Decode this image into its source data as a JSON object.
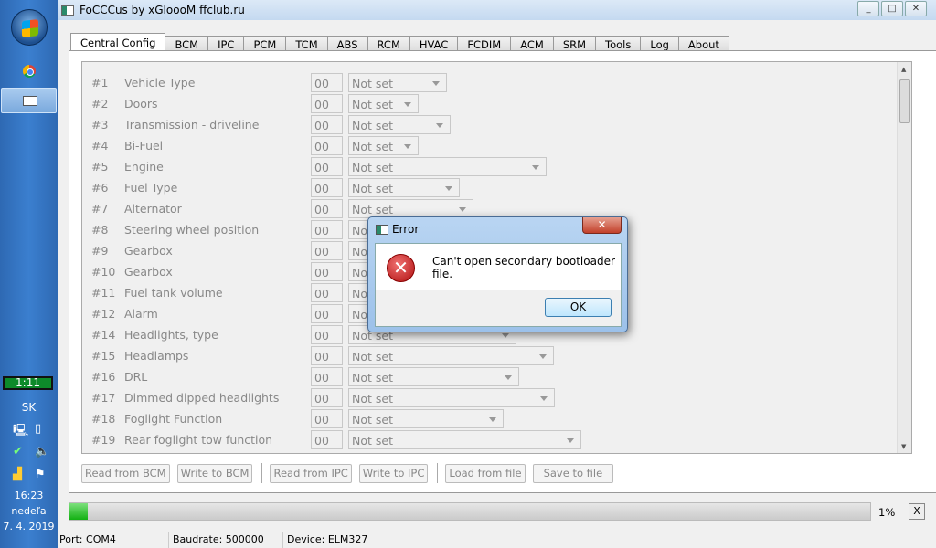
{
  "taskbar": {
    "battery": "1:11",
    "lang": "SK",
    "time": "16:23",
    "day": "nedeľa",
    "date": "7. 4. 2019"
  },
  "window": {
    "title": "FoCCCus by xGloooM ffclub.ru",
    "controls": [
      "_",
      "□",
      "✕"
    ]
  },
  "tabs": [
    "Central Config",
    "BCM",
    "IPC",
    "PCM",
    "TCM",
    "ABS",
    "RCM",
    "HVAC",
    "FCDIM",
    "ACM",
    "SRM",
    "Tools",
    "Log",
    "About"
  ],
  "active_tab": "Central Config",
  "rows": [
    {
      "num": "#1",
      "label": "Vehicle Type",
      "value": "00",
      "select": "Not set"
    },
    {
      "num": "#2",
      "label": "Doors",
      "value": "00",
      "select": "Not set"
    },
    {
      "num": "#3",
      "label": "Transmission - driveline",
      "value": "00",
      "select": "Not set"
    },
    {
      "num": "#4",
      "label": "Bi-Fuel",
      "value": "00",
      "select": "Not set"
    },
    {
      "num": "#5",
      "label": "Engine",
      "value": "00",
      "select": "Not set"
    },
    {
      "num": "#6",
      "label": "Fuel Type",
      "value": "00",
      "select": "Not set"
    },
    {
      "num": "#7",
      "label": "Alternator",
      "value": "00",
      "select": "Not set"
    },
    {
      "num": "#8",
      "label": "Steering wheel position",
      "value": "00",
      "select": "Not set"
    },
    {
      "num": "#9",
      "label": "Gearbox",
      "value": "00",
      "select": "Not set"
    },
    {
      "num": "#10",
      "label": "Gearbox",
      "value": "00",
      "select": "Not set"
    },
    {
      "num": "#11",
      "label": "Fuel tank volume",
      "value": "00",
      "select": "Not set"
    },
    {
      "num": "#12",
      "label": "Alarm",
      "value": "00",
      "select": "Not set"
    },
    {
      "num": "#14",
      "label": "Headlights, type",
      "value": "00",
      "select": "Not set"
    },
    {
      "num": "#15",
      "label": "Headlamps",
      "value": "00",
      "select": "Not set"
    },
    {
      "num": "#16",
      "label": "DRL",
      "value": "00",
      "select": "Not set"
    },
    {
      "num": "#17",
      "label": "Dimmed dipped headlights",
      "value": "00",
      "select": "Not set"
    },
    {
      "num": "#18",
      "label": "Foglight Function",
      "value": "00",
      "select": "Not set"
    },
    {
      "num": "#19",
      "label": "Rear foglight tow function",
      "value": "00",
      "select": "Not set"
    }
  ],
  "buttons": [
    "Read from BCM",
    "Write to BCM",
    "Read from IPC",
    "Write to IPC",
    "Load from file",
    "Save to file"
  ],
  "progress": {
    "percent": 1,
    "label": "1%",
    "cancel": "X"
  },
  "status": {
    "port": "Port: COM4",
    "baudrate": "Baudrate: 500000",
    "device": "Device: ELM327"
  },
  "dialog": {
    "title": "Error",
    "message": "Can't open secondary bootloader file.",
    "ok": "OK",
    "close": "✕"
  }
}
